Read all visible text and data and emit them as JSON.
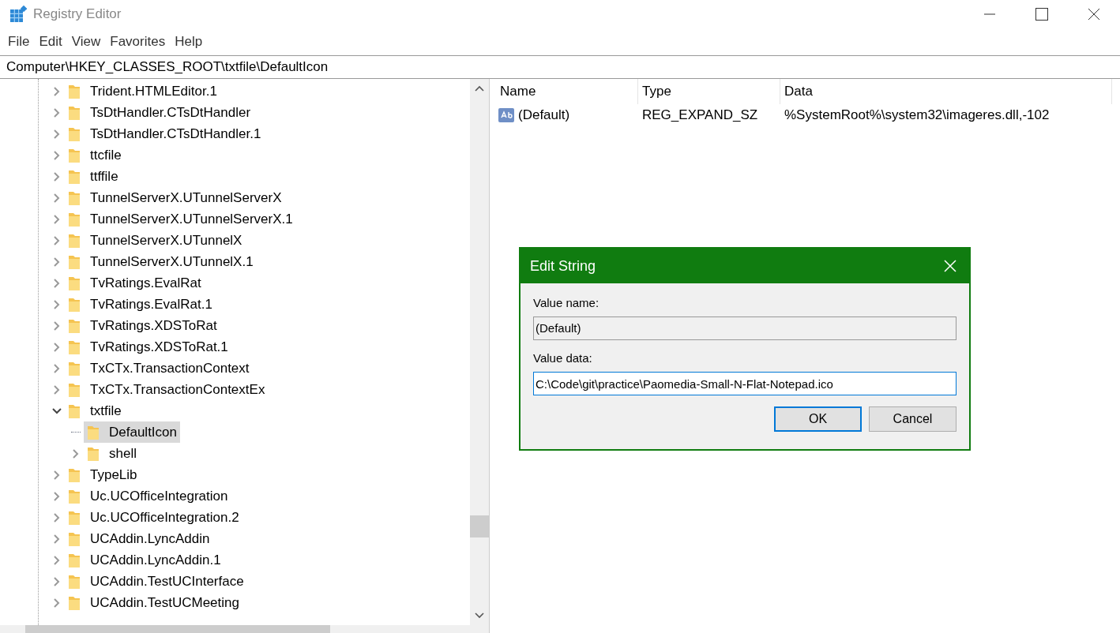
{
  "window": {
    "title": "Registry Editor"
  },
  "menu": [
    "File",
    "Edit",
    "View",
    "Favorites",
    "Help"
  ],
  "address": "Computer\\HKEY_CLASSES_ROOT\\txtfile\\DefaultIcon",
  "tree": [
    {
      "label": "Trident.HTMLEditor.1",
      "kind": "node",
      "expanded": false,
      "selected": false
    },
    {
      "label": "TsDtHandler.CTsDtHandler",
      "kind": "node",
      "expanded": false,
      "selected": false
    },
    {
      "label": "TsDtHandler.CTsDtHandler.1",
      "kind": "node",
      "expanded": false,
      "selected": false
    },
    {
      "label": "ttcfile",
      "kind": "node",
      "expanded": false,
      "selected": false
    },
    {
      "label": "ttffile",
      "kind": "node",
      "expanded": false,
      "selected": false
    },
    {
      "label": "TunnelServerX.UTunnelServerX",
      "kind": "node",
      "expanded": false,
      "selected": false
    },
    {
      "label": "TunnelServerX.UTunnelServerX.1",
      "kind": "node",
      "expanded": false,
      "selected": false
    },
    {
      "label": "TunnelServerX.UTunnelX",
      "kind": "node",
      "expanded": false,
      "selected": false
    },
    {
      "label": "TunnelServerX.UTunnelX.1",
      "kind": "node",
      "expanded": false,
      "selected": false
    },
    {
      "label": "TvRatings.EvalRat",
      "kind": "node",
      "expanded": false,
      "selected": false
    },
    {
      "label": "TvRatings.EvalRat.1",
      "kind": "node",
      "expanded": false,
      "selected": false
    },
    {
      "label": "TvRatings.XDSToRat",
      "kind": "node",
      "expanded": false,
      "selected": false
    },
    {
      "label": "TvRatings.XDSToRat.1",
      "kind": "node",
      "expanded": false,
      "selected": false
    },
    {
      "label": "TxCTx.TransactionContext",
      "kind": "node",
      "expanded": false,
      "selected": false
    },
    {
      "label": "TxCTx.TransactionContextEx",
      "kind": "node",
      "expanded": false,
      "selected": false
    },
    {
      "label": "txtfile",
      "kind": "node",
      "expanded": true,
      "selected": false,
      "children": [
        {
          "label": "DefaultIcon",
          "kind": "leaf",
          "selected": true
        },
        {
          "label": "shell",
          "kind": "node",
          "expanded": false,
          "selected": false
        }
      ]
    },
    {
      "label": "TypeLib",
      "kind": "node",
      "expanded": false,
      "selected": false
    },
    {
      "label": "Uc.UCOfficeIntegration",
      "kind": "node",
      "expanded": false,
      "selected": false
    },
    {
      "label": "Uc.UCOfficeIntegration.2",
      "kind": "node",
      "expanded": false,
      "selected": false
    },
    {
      "label": "UCAddin.LyncAddin",
      "kind": "node",
      "expanded": false,
      "selected": false
    },
    {
      "label": "UCAddin.LyncAddin.1",
      "kind": "node",
      "expanded": false,
      "selected": false
    },
    {
      "label": "UCAddin.TestUCInterface",
      "kind": "node",
      "expanded": false,
      "selected": false
    },
    {
      "label": "UCAddin.TestUCMeeting",
      "kind": "node",
      "expanded": false,
      "selected": false
    }
  ],
  "values": {
    "columns": [
      "Name",
      "Type",
      "Data"
    ],
    "rows": [
      {
        "name": "(Default)",
        "type": "REG_EXPAND_SZ",
        "data": "%SystemRoot%\\system32\\imageres.dll,-102"
      }
    ]
  },
  "dialog": {
    "title": "Edit String",
    "name_label": "Value name:",
    "name_value": "(Default)",
    "data_label": "Value data:",
    "data_value": "C:\\Code\\git\\practice\\Paomedia-Small-N-Flat-Notepad.ico",
    "buttons": [
      "OK",
      "Cancel"
    ]
  }
}
